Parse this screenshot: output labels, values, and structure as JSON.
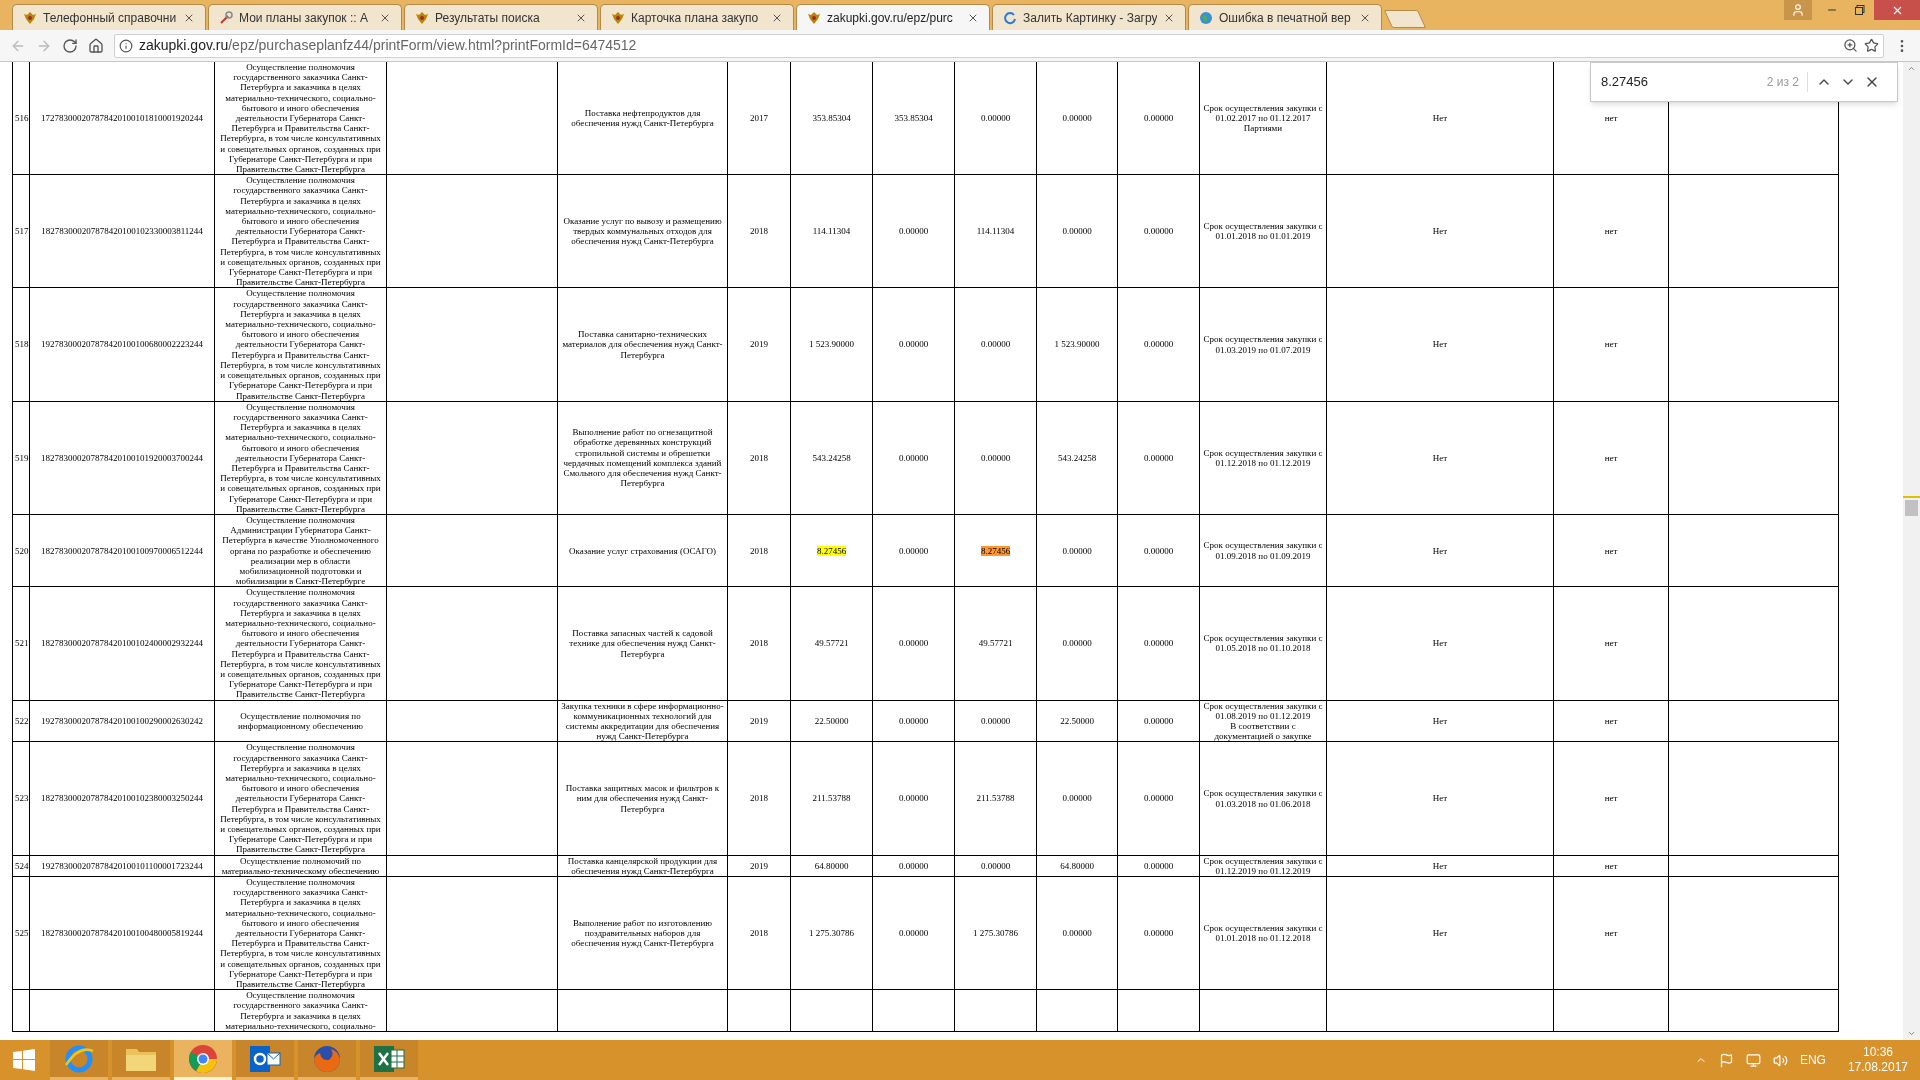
{
  "tabs": [
    {
      "title": "Телефонный справочни",
      "selected": false
    },
    {
      "title": "Мои планы закупок :: А",
      "selected": false
    },
    {
      "title": "Результаты поиска",
      "selected": false
    },
    {
      "title": "Карточка плана закупо",
      "selected": false
    },
    {
      "title": "zakupki.gov.ru/epz/purc",
      "selected": true
    },
    {
      "title": "Залить Картинку - Загру",
      "selected": false
    },
    {
      "title": "Ошибка в печатной вер",
      "selected": false
    }
  ],
  "address_bar": {
    "host": "zakupki.gov.ru",
    "path": "/epz/purchaseplanfz44/printForm/view.html?printFormId=6474512"
  },
  "find_bar": {
    "value": "8.27456",
    "count": "2 из 2"
  },
  "table": {
    "rows": [
      {
        "number": "516",
        "code": "172783000207878420100101810001920244",
        "purpose": "Осуществление полномочия государственного заказчика Санкт-Петербурга и заказчика в целях материально-технического, социально-бытового и иного обеспечения деятельности Губернатора Санкт-Петербурга и Правительства Санкт-Петербурга, в том числе консультативных и совещательных органов, созданных при Губернаторе Санкт-Петербурга и при Правительстве Санкт-Петербурга",
        "subject": "Поставка нефтепродуктов для обеспечения нужд Санкт-Петербурга",
        "year": "2017",
        "amounts": [
          {
            "text": "353.85304",
            "match": false,
            "selected": false
          },
          {
            "text": "353.85304",
            "match": false,
            "selected": false
          },
          {
            "text": "0.00000",
            "match": false,
            "selected": false
          },
          {
            "text": "0.00000",
            "match": false,
            "selected": false
          },
          {
            "text": "0.00000",
            "match": false,
            "selected": false
          }
        ],
        "term": [
          "Срок осуществления закупки с 01.02.2017 по 01.12.2017",
          "Партиями"
        ],
        "column_13": "Нет",
        "column_14": "нет"
      },
      {
        "number": "517",
        "code": "182783000207878420100102330003811244",
        "purpose": "Осуществление полномочия государственного заказчика Санкт-Петербурга и заказчика в целях материально-технического, социально-бытового и иного обеспечения деятельности Губернатора Санкт-Петербурга и Правительства Санкт-Петербурга, в том числе консультативных и совещательных органов, созданных при Губернаторе Санкт-Петербурга и при Правительстве Санкт-Петербурга",
        "subject": "Оказание услуг по вывозу и размещению твердых коммунальных отходов для обеспечения нужд Санкт-Петербурга",
        "year": "2018",
        "amounts": [
          {
            "text": "114.11304",
            "match": false,
            "selected": false
          },
          {
            "text": "0.00000",
            "match": false,
            "selected": false
          },
          {
            "text": "114.11304",
            "match": false,
            "selected": false
          },
          {
            "text": "0.00000",
            "match": false,
            "selected": false
          },
          {
            "text": "0.00000",
            "match": false,
            "selected": false
          }
        ],
        "term": [
          "Срок осуществления закупки с 01.01.2018 по 01.01.2019"
        ],
        "column_13": "Нет",
        "column_14": "нет"
      },
      {
        "number": "518",
        "code": "192783000207878420100100680002223244",
        "purpose": "Осуществление полномочия государственного заказчика Санкт-Петербурга и заказчика в целях материально-технического, социально-бытового и иного обеспечения деятельности Губернатора Санкт-Петербурга и Правительства Санкт-Петербурга, в том числе консультативных и совещательных органов, созданных при Губернаторе Санкт-Петербурга и при Правительстве Санкт-Петербурга",
        "subject": "Поставка санитарно-технических материалов для обеспечения нужд Санкт-Петербурга",
        "year": "2019",
        "amounts": [
          {
            "text": "1 523.90000",
            "match": false,
            "selected": false
          },
          {
            "text": "0.00000",
            "match": false,
            "selected": false
          },
          {
            "text": "0.00000",
            "match": false,
            "selected": false
          },
          {
            "text": "1 523.90000",
            "match": false,
            "selected": false
          },
          {
            "text": "0.00000",
            "match": false,
            "selected": false
          }
        ],
        "term": [
          "Срок осуществления закупки с 01.03.2019 по 01.07.2019"
        ],
        "column_13": "Нет",
        "column_14": "нет"
      },
      {
        "number": "519",
        "code": "182783000207878420100101920003700244",
        "purpose": "Осуществление полномочия государственного заказчика Санкт-Петербурга и заказчика в целях материально-технического, социально-бытового и иного обеспечения деятельности Губернатора Санкт-Петербурга и Правительства Санкт-Петербурга, в том числе консультативных и совещательных органов, созданных при Губернаторе Санкт-Петербурга и при Правительстве Санкт-Петербурга",
        "subject": "Выполнение работ по огнезащитной обработке деревянных конструкций стропильной системы и обрешетки чердачных помещений комплекса зданий Смольного для обеспечения нужд Санкт-Петербурга",
        "year": "2018",
        "amounts": [
          {
            "text": "543.24258",
            "match": false,
            "selected": false
          },
          {
            "text": "0.00000",
            "match": false,
            "selected": false
          },
          {
            "text": "0.00000",
            "match": false,
            "selected": false
          },
          {
            "text": "543.24258",
            "match": false,
            "selected": false
          },
          {
            "text": "0.00000",
            "match": false,
            "selected": false
          }
        ],
        "term": [
          "Срок осуществления закупки с 01.12.2018 по 01.12.2019"
        ],
        "column_13": "Нет",
        "column_14": "нет"
      },
      {
        "number": "520",
        "code": "182783000207878420100100970006512244",
        "purpose": "Осуществление полномочия Администрации Губернатора Санкт-Петербурга в качестве Уполномоченного органа по разработке и обеспечению реализации мер в области мобилизационной подготовки и мобилизации в Санкт-Петербурге",
        "subject": "Оказание услуг страхования (ОСАГО)",
        "year": "2018",
        "amounts": [
          {
            "text": "8.27456",
            "match": true,
            "selected": false
          },
          {
            "text": "0.00000",
            "match": false,
            "selected": false
          },
          {
            "text": "8.27456",
            "match": true,
            "selected": true
          },
          {
            "text": "0.00000",
            "match": false,
            "selected": false
          },
          {
            "text": "0.00000",
            "match": false,
            "selected": false
          }
        ],
        "term": [
          "Срок осуществления закупки с 01.09.2018 по 01.09.2019"
        ],
        "column_13": "Нет",
        "column_14": "нет"
      },
      {
        "number": "521",
        "code": "182783000207878420100102400002932244",
        "purpose": "Осуществление полномочия государственного заказчика Санкт-Петербурга и заказчика в целях материально-технического, социально-бытового и иного обеспечения деятельности Губернатора Санкт-Петербурга и Правительства Санкт-Петербурга, в том числе консультативных и совещательных органов, созданных при Губернаторе Санкт-Петербурга и при Правительстве Санкт-Петербурга",
        "subject": "Поставка запасных частей к садовой технике для обеспечения нужд Санкт-Петербурга",
        "year": "2018",
        "amounts": [
          {
            "text": "49.57721",
            "match": false,
            "selected": false
          },
          {
            "text": "0.00000",
            "match": false,
            "selected": false
          },
          {
            "text": "49.57721",
            "match": false,
            "selected": false
          },
          {
            "text": "0.00000",
            "match": false,
            "selected": false
          },
          {
            "text": "0.00000",
            "match": false,
            "selected": false
          }
        ],
        "term": [
          "Срок осуществления закупки с 01.05.2018 по 01.10.2018"
        ],
        "column_13": "Нет",
        "column_14": "нет"
      },
      {
        "number": "522",
        "code": "192783000207878420100100290002630242",
        "purpose": "Осуществление полномочия по информационному обеспечению",
        "subject": "Закупка техники в сфере информационно-коммуникационных технологий для системы аккредитации для обеспечения нужд Санкт-Петербурга",
        "year": "2019",
        "amounts": [
          {
            "text": "22.50000",
            "match": false,
            "selected": false
          },
          {
            "text": "0.00000",
            "match": false,
            "selected": false
          },
          {
            "text": "0.00000",
            "match": false,
            "selected": false
          },
          {
            "text": "22.50000",
            "match": false,
            "selected": false
          },
          {
            "text": "0.00000",
            "match": false,
            "selected": false
          }
        ],
        "term": [
          "Срок осуществления закупки с 01.08.2019 по 01.12.2019",
          "В соответствии с документацией о закупке"
        ],
        "column_13": "Нет",
        "column_14": "нет"
      },
      {
        "number": "523",
        "code": "182783000207878420100102380003250244",
        "purpose": "Осуществление полномочия государственного заказчика Санкт-Петербурга и заказчика в целях материально-технического, социально-бытового и иного обеспечения деятельности Губернатора Санкт-Петербурга и Правительства Санкт-Петербурга, в том числе консультативных и совещательных органов, созданных при Губернаторе Санкт-Петербурга и при Правительстве Санкт-Петербурга",
        "subject": "Поставка защитных масок и фильтров к ним для обеспечения нужд Санкт-Петербурга",
        "year": "2018",
        "amounts": [
          {
            "text": "211.53788",
            "match": false,
            "selected": false
          },
          {
            "text": "0.00000",
            "match": false,
            "selected": false
          },
          {
            "text": "211.53788",
            "match": false,
            "selected": false
          },
          {
            "text": "0.00000",
            "match": false,
            "selected": false
          },
          {
            "text": "0.00000",
            "match": false,
            "selected": false
          }
        ],
        "term": [
          "Срок осуществления закупки с 01.03.2018 по 01.06.2018"
        ],
        "column_13": "Нет",
        "column_14": "нет"
      },
      {
        "number": "524",
        "code": "192783000207878420100101100001723244",
        "purpose": "Осуществление полномочий по материально-техническому обеспечению",
        "subject": "Поставка канцелярской продукции для обеспечения нужд Санкт-Петербурга",
        "year": "2019",
        "amounts": [
          {
            "text": "64.80000",
            "match": false,
            "selected": false
          },
          {
            "text": "0.00000",
            "match": false,
            "selected": false
          },
          {
            "text": "0.00000",
            "match": false,
            "selected": false
          },
          {
            "text": "64.80000",
            "match": false,
            "selected": false
          },
          {
            "text": "0.00000",
            "match": false,
            "selected": false
          }
        ],
        "term": [
          "Срок осуществления закупки с 01.12.2019 по 01.12.2019"
        ],
        "column_13": "Нет",
        "column_14": "нет"
      },
      {
        "number": "525",
        "code": "182783000207878420100100480005819244",
        "purpose": "Осуществление полномочия государственного заказчика Санкт-Петербурга и заказчика в целях материально-технического, социально-бытового и иного обеспечения деятельности Губернатора Санкт-Петербурга и Правительства Санкт-Петербурга, в том числе консультативных и совещательных органов, созданных при Губернаторе Санкт-Петербурга и при Правительстве Санкт-Петербурга",
        "subject": "Выполнение работ по изготовлению поздравительных наборов для обеспечения нужд Санкт-Петербурга",
        "year": "2018",
        "amounts": [
          {
            "text": "1 275.30786",
            "match": false,
            "selected": false
          },
          {
            "text": "0.00000",
            "match": false,
            "selected": false
          },
          {
            "text": "1 275.30786",
            "match": false,
            "selected": false
          },
          {
            "text": "0.00000",
            "match": false,
            "selected": false
          },
          {
            "text": "0.00000",
            "match": false,
            "selected": false
          }
        ],
        "term": [
          "Срок осуществления закупки с 01.01.2018 по 01.12.2018"
        ],
        "column_13": "Нет",
        "column_14": "нет"
      },
      {
        "purpose": "Осуществление полномочия государственного заказчика Санкт-Петербурга и заказчика в целях материально-технического, социально-"
      }
    ]
  },
  "taskbar": {
    "apps": [
      {
        "kind": "ie",
        "selected": false
      },
      {
        "kind": "folder",
        "selected": false
      },
      {
        "kind": "chrome",
        "selected": true
      },
      {
        "kind": "outlook",
        "selected": false
      },
      {
        "kind": "firefox",
        "selected": false
      },
      {
        "kind": "excel",
        "selected": false
      }
    ],
    "language": "ENG",
    "time": "10:36",
    "date": "17.08.2017"
  }
}
